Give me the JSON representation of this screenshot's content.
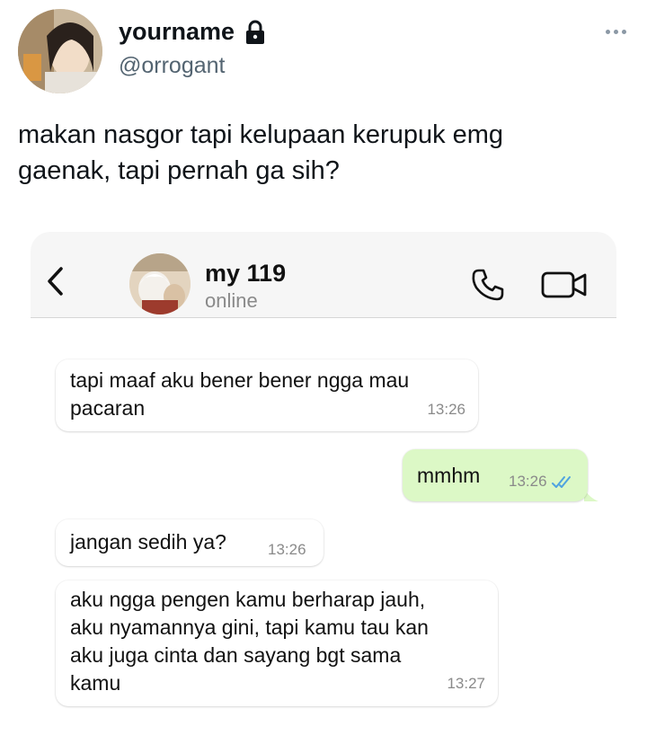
{
  "tweet": {
    "display_name": "yourname",
    "handle": "@orrogant",
    "text": "makan nasgor tapi kelupaan kerupuk emg\ngaenak, tapi pernah ga sih?"
  },
  "icons": {
    "lock": "lock-icon",
    "more": "more-options-icon",
    "back": "chevron-left-icon",
    "call": "phone-icon",
    "video": "video-camera-icon",
    "read_receipt": "double-check-icon"
  },
  "colors": {
    "outgoing_bubble": "#dcf8c6",
    "incoming_bubble": "#ffffff",
    "read_receipt": "#4fa3e0",
    "handle": "#536471"
  },
  "chat": {
    "contact_name": "my 119",
    "contact_status": "online",
    "messages": [
      {
        "direction": "in",
        "text": "tapi maaf aku bener bener ngga mau\npacaran",
        "time": "13:26"
      },
      {
        "direction": "out",
        "text": "mmhm",
        "time": "13:26"
      },
      {
        "direction": "in",
        "text": "jangan sedih ya?",
        "time": "13:26"
      },
      {
        "direction": "in",
        "text": "aku ngga pengen kamu berharap jauh,\naku nyamannya gini, tapi kamu tau kan\naku juga cinta dan sayang bgt sama\nkamu",
        "time": "13:27"
      }
    ]
  }
}
